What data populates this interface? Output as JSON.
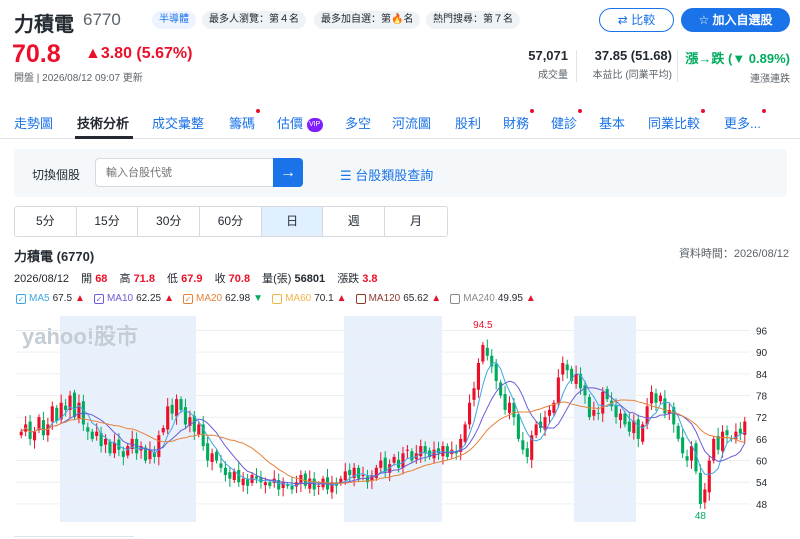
{
  "header": {
    "stock_name": "力積電",
    "stock_code": "6770",
    "tags": [
      {
        "label": "半導體",
        "style": "blue"
      },
      {
        "label": "最多人瀏覽：第４名",
        "style": "gray"
      },
      {
        "label": "最多加自選：第🔥名",
        "style": "gray"
      },
      {
        "label": "熱門搜尋：第７名",
        "style": "gray"
      }
    ],
    "compare_label": "比較",
    "add_watchlist_label": "加入自選股",
    "price": "70.8",
    "change": "▲3.80 (5.67%)",
    "status": "開盤 | 2026/08/12 09:07 更新"
  },
  "stats": {
    "volume_value": "57,071",
    "volume_label": "成交量",
    "pe_value": "37.85 (51.68)",
    "pe_label": "本益比 (同業平均)",
    "breadth_value": "漲→跌 (▼ 0.89%)",
    "breadth_label": "連漲連跌"
  },
  "tabs": [
    {
      "label": "走勢圖",
      "dot": false
    },
    {
      "label": "技術分析",
      "dot": false,
      "active": true
    },
    {
      "label": "成交彙整",
      "dot": false
    },
    {
      "label": "籌碼",
      "dot": true
    },
    {
      "label": "估價",
      "dot": false,
      "vip": "VIP"
    },
    {
      "label": "多空",
      "dot": false
    },
    {
      "label": "河流圖",
      "dot": false
    },
    {
      "label": "股利",
      "dot": false
    },
    {
      "label": "財務",
      "dot": true
    },
    {
      "label": "健診",
      "dot": true
    },
    {
      "label": "基本",
      "dot": false
    },
    {
      "label": "同業比較",
      "dot": true
    },
    {
      "label": "更多",
      "dot": true
    }
  ],
  "switcher": {
    "label": "切換個股",
    "placeholder": "輸入台股代號",
    "lookup_label": "台股類股查詢"
  },
  "periods": [
    "5分",
    "15分",
    "30分",
    "60分",
    "日",
    "週",
    "月"
  ],
  "active_period": "日",
  "chart_header": {
    "title": "力積電 (6770)",
    "data_time": "資料時間：2026/08/12",
    "date": "2026/08/12",
    "open_label": "開",
    "open": "68",
    "high_label": "高",
    "high": "71.8",
    "low_label": "低",
    "low": "67.9",
    "close_label": "收",
    "close": "70.8",
    "vol_label": "量(張)",
    "vol": "56801",
    "chg_label": "漲跌",
    "chg": "3.8"
  },
  "legend": [
    {
      "name": "MA5",
      "value": "67.5",
      "arrow": "▲",
      "color": "#3da5e6",
      "arrow_color": "#eb0f29"
    },
    {
      "name": "MA10",
      "value": "62.25",
      "arrow": "▲",
      "color": "#6c5bd7",
      "arrow_color": "#eb0f29"
    },
    {
      "name": "MA20",
      "value": "62.98",
      "arrow": "▼",
      "color": "#e6813a",
      "arrow_color": "#00ab5e"
    },
    {
      "name": "MA60",
      "value": "70.1",
      "arrow": "▲",
      "color": "#f2b544",
      "arrow_color": "#eb0f29"
    },
    {
      "name": "MA120",
      "value": "65.62",
      "arrow": "▲",
      "color": "#8b3a2a",
      "arrow_color": "#eb0f29"
    },
    {
      "name": "MA240",
      "value": "49.95",
      "arrow": "▲",
      "color": "#8a8a8a",
      "arrow_color": "#eb0f29"
    }
  ],
  "watermark": "yahoo!股市",
  "colors": {
    "up": "#eb0f29",
    "down": "#00ab5e",
    "accent": "#1a73e8",
    "band": "#e8f1fb"
  },
  "chart_data": {
    "type": "candlestick",
    "y_ticks": [
      48,
      54,
      60,
      66,
      72,
      78,
      84,
      90,
      96
    ],
    "ylim": [
      43,
      100
    ],
    "annotations": {
      "high": "94.5",
      "low": "48"
    },
    "closes": [
      68,
      70,
      66,
      68,
      72,
      67,
      70,
      75,
      71,
      76,
      74,
      78,
      72,
      76,
      70,
      68,
      66,
      68,
      64,
      66,
      62,
      65,
      63,
      61,
      64,
      66,
      62,
      64,
      60,
      63,
      61,
      67,
      69,
      75,
      73,
      77,
      74,
      70,
      72,
      68,
      70,
      64,
      60,
      62,
      60,
      58,
      56,
      55,
      57,
      54,
      55,
      53,
      56,
      55,
      54,
      54,
      53,
      55,
      52,
      54,
      53,
      52,
      54,
      56,
      53,
      55,
      52,
      53,
      55,
      52,
      54,
      53,
      55,
      57,
      56,
      58,
      55,
      56,
      54,
      56,
      58,
      60,
      57,
      59,
      61,
      58,
      62,
      63,
      60,
      62,
      64,
      62,
      61,
      63,
      62,
      64,
      61,
      63,
      62,
      66,
      70,
      76,
      80,
      87,
      92,
      89,
      86,
      82,
      78,
      74,
      76,
      72,
      66,
      63,
      61,
      67,
      70,
      69,
      72,
      74,
      76,
      83,
      87,
      85,
      82,
      84,
      80,
      78,
      72,
      74,
      73,
      79,
      77,
      75,
      72,
      73,
      70,
      68,
      71,
      66,
      70,
      75,
      79,
      76,
      78,
      73,
      74,
      70,
      66,
      62,
      60,
      64,
      57,
      48,
      52,
      60,
      66,
      63,
      68,
      67,
      66,
      68,
      67.5,
      70.8
    ]
  }
}
